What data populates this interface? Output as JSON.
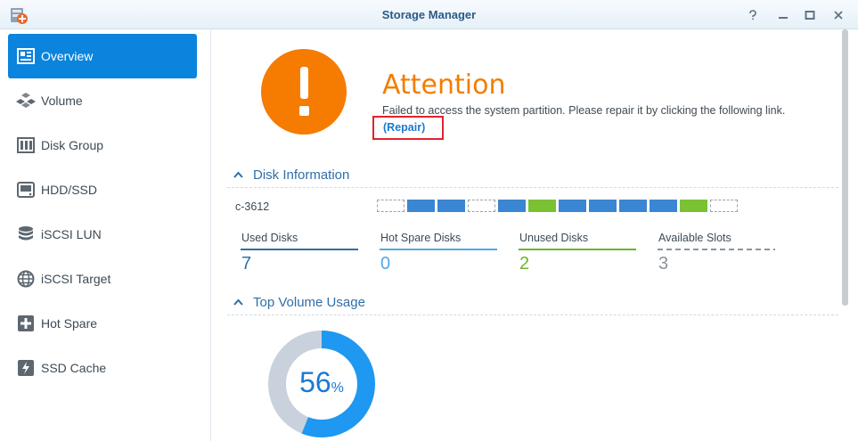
{
  "window": {
    "title": "Storage Manager",
    "help_icon": "help-icon",
    "minimize_icon": "minimize-icon",
    "maximize_icon": "maximize-icon",
    "close_icon": "close-icon"
  },
  "sidebar": {
    "items": [
      {
        "label": "Overview",
        "icon": "overview-icon",
        "active": true
      },
      {
        "label": "Volume",
        "icon": "volume-icon"
      },
      {
        "label": "Disk Group",
        "icon": "disk-group-icon"
      },
      {
        "label": "HDD/SSD",
        "icon": "hdd-icon"
      },
      {
        "label": "iSCSI LUN",
        "icon": "iscsi-lun-icon"
      },
      {
        "label": "iSCSI Target",
        "icon": "iscsi-target-icon"
      },
      {
        "label": "Hot Spare",
        "icon": "hot-spare-icon"
      },
      {
        "label": "SSD Cache",
        "icon": "ssd-cache-icon"
      }
    ]
  },
  "status": {
    "title": "Attention",
    "message": "Failed to access the system partition. Please repair it by clicking the following link.",
    "link": "(Repair)",
    "color": "#f57c00"
  },
  "disk_info": {
    "header": "Disk Information",
    "model": "c-3612",
    "slots": [
      "empty",
      "blue",
      "blue",
      "empty",
      "blue",
      "green",
      "blue",
      "blue",
      "blue",
      "blue",
      "green",
      "empty"
    ],
    "stats": [
      {
        "label": "Used Disks",
        "value": "7",
        "color": "#2f6fa8"
      },
      {
        "label": "Hot Spare Disks",
        "value": "0",
        "color": "#55a7e6"
      },
      {
        "label": "Unused Disks",
        "value": "2",
        "color": "#6cb52d"
      },
      {
        "label": "Available Slots",
        "value": "3",
        "color": "#8c949a"
      }
    ]
  },
  "volume_usage": {
    "header": "Top Volume Usage",
    "percent_value": "56",
    "percent_sign": "%",
    "fill_fraction": 0.56
  }
}
